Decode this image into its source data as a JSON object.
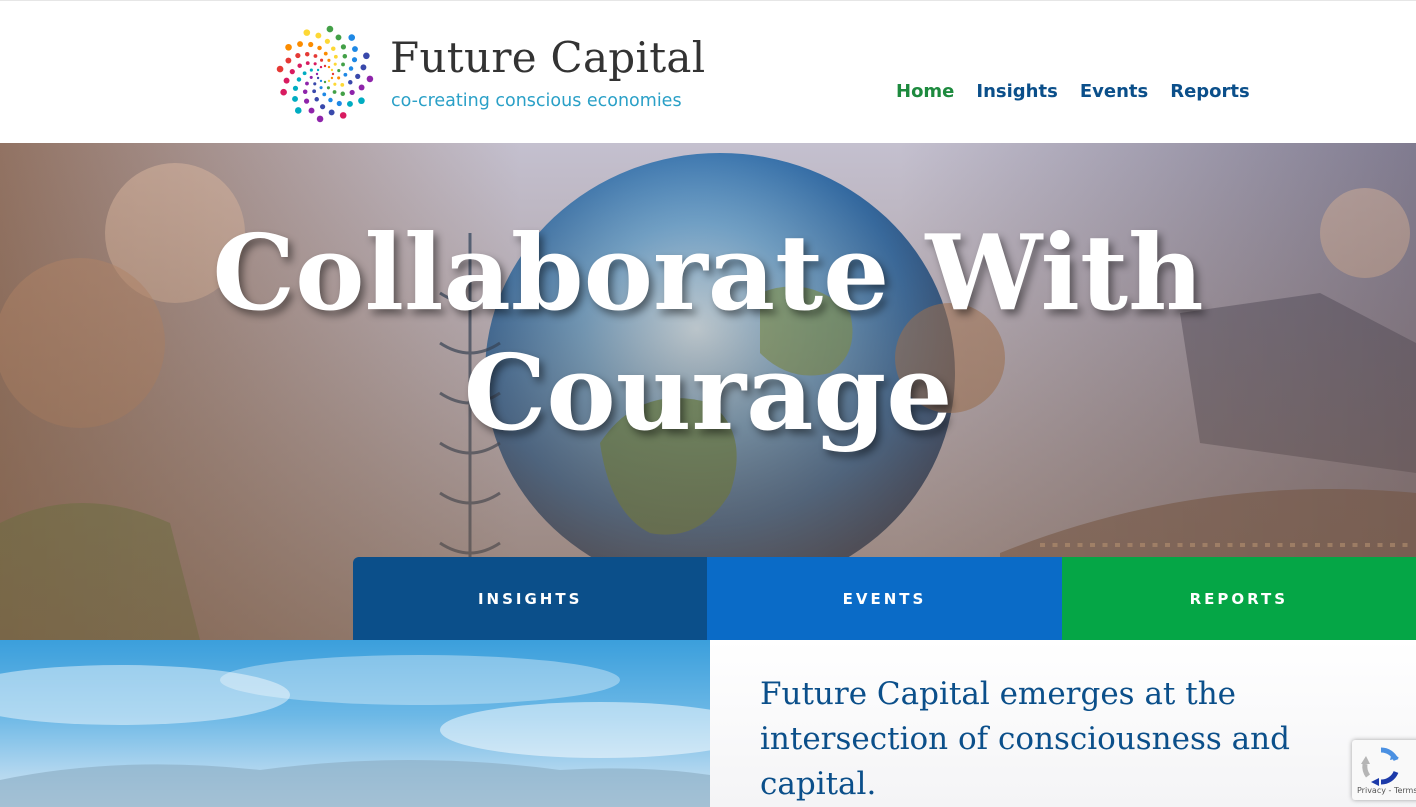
{
  "brand": {
    "name": "Future Capital",
    "tagline": "co-creating conscious economies"
  },
  "nav": {
    "items": [
      {
        "label": "Home",
        "active": true
      },
      {
        "label": "Insights",
        "active": false
      },
      {
        "label": "Events",
        "active": false
      },
      {
        "label": "Reports",
        "active": false
      }
    ]
  },
  "hero": {
    "title_line1": "Collaborate With",
    "title_line2": "Courage"
  },
  "cta": {
    "insights": "INSIGHTS",
    "events": "EVENTS",
    "reports": "REPORTS"
  },
  "intro": {
    "text": "Future Capital emerges at the intersection of consciousness and capital."
  },
  "recaptcha": {
    "links": "Privacy - Terms"
  },
  "colors": {
    "nav_active": "#1d8a3e",
    "nav_default": "#0b4f8a",
    "insights": "#0b4f8a",
    "events": "#0a6bc7",
    "reports": "#05a646",
    "tagline": "#2aa0c7"
  }
}
